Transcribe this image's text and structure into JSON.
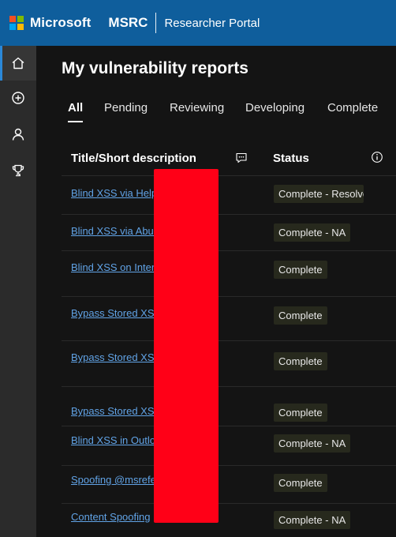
{
  "header": {
    "brand": "Microsoft",
    "product": "MSRC",
    "portal": "Researcher Portal",
    "logo_colors": [
      "#f25022",
      "#7fba00",
      "#00a4ef",
      "#ffb900"
    ]
  },
  "rail": {
    "items": [
      {
        "name": "home-icon",
        "active": true
      },
      {
        "name": "add-circle-icon",
        "active": false
      },
      {
        "name": "person-icon",
        "active": false
      },
      {
        "name": "trophy-icon",
        "active": false
      }
    ]
  },
  "page": {
    "title": "My vulnerability reports"
  },
  "tabs": [
    "All",
    "Pending",
    "Reviewing",
    "Developing",
    "Complete"
  ],
  "table": {
    "columns": {
      "title": "Title/Short description",
      "comment_icon": "comment-icon",
      "status": "Status",
      "info_icon": "info-icon"
    },
    "rows": [
      {
        "title": "Blind XSS via Help",
        "status": "Complete - Resolve"
      },
      {
        "title": "Blind XSS via Abuse",
        "status": "Complete - NA"
      },
      {
        "title": "Blind XSS on Intern",
        "status": "Complete"
      },
      {
        "title": "Bypass Stored XSS",
        "status": "Complete"
      },
      {
        "title": "Bypass Stored XSS",
        "status": "Complete"
      },
      {
        "title": "Bypass Stored XSS",
        "status": "Complete"
      },
      {
        "title": "Blind XSS in Outloo",
        "status": "Complete - NA"
      },
      {
        "title": "Spoofing @msrefer",
        "status": "Complete"
      },
      {
        "title": "Content Spoofing",
        "status": "Complete - NA"
      }
    ]
  },
  "colors": {
    "topbar": "#0f5e9c",
    "link": "#61a3e6",
    "badge_bg": "#27291d",
    "redaction": "#ff0017"
  }
}
